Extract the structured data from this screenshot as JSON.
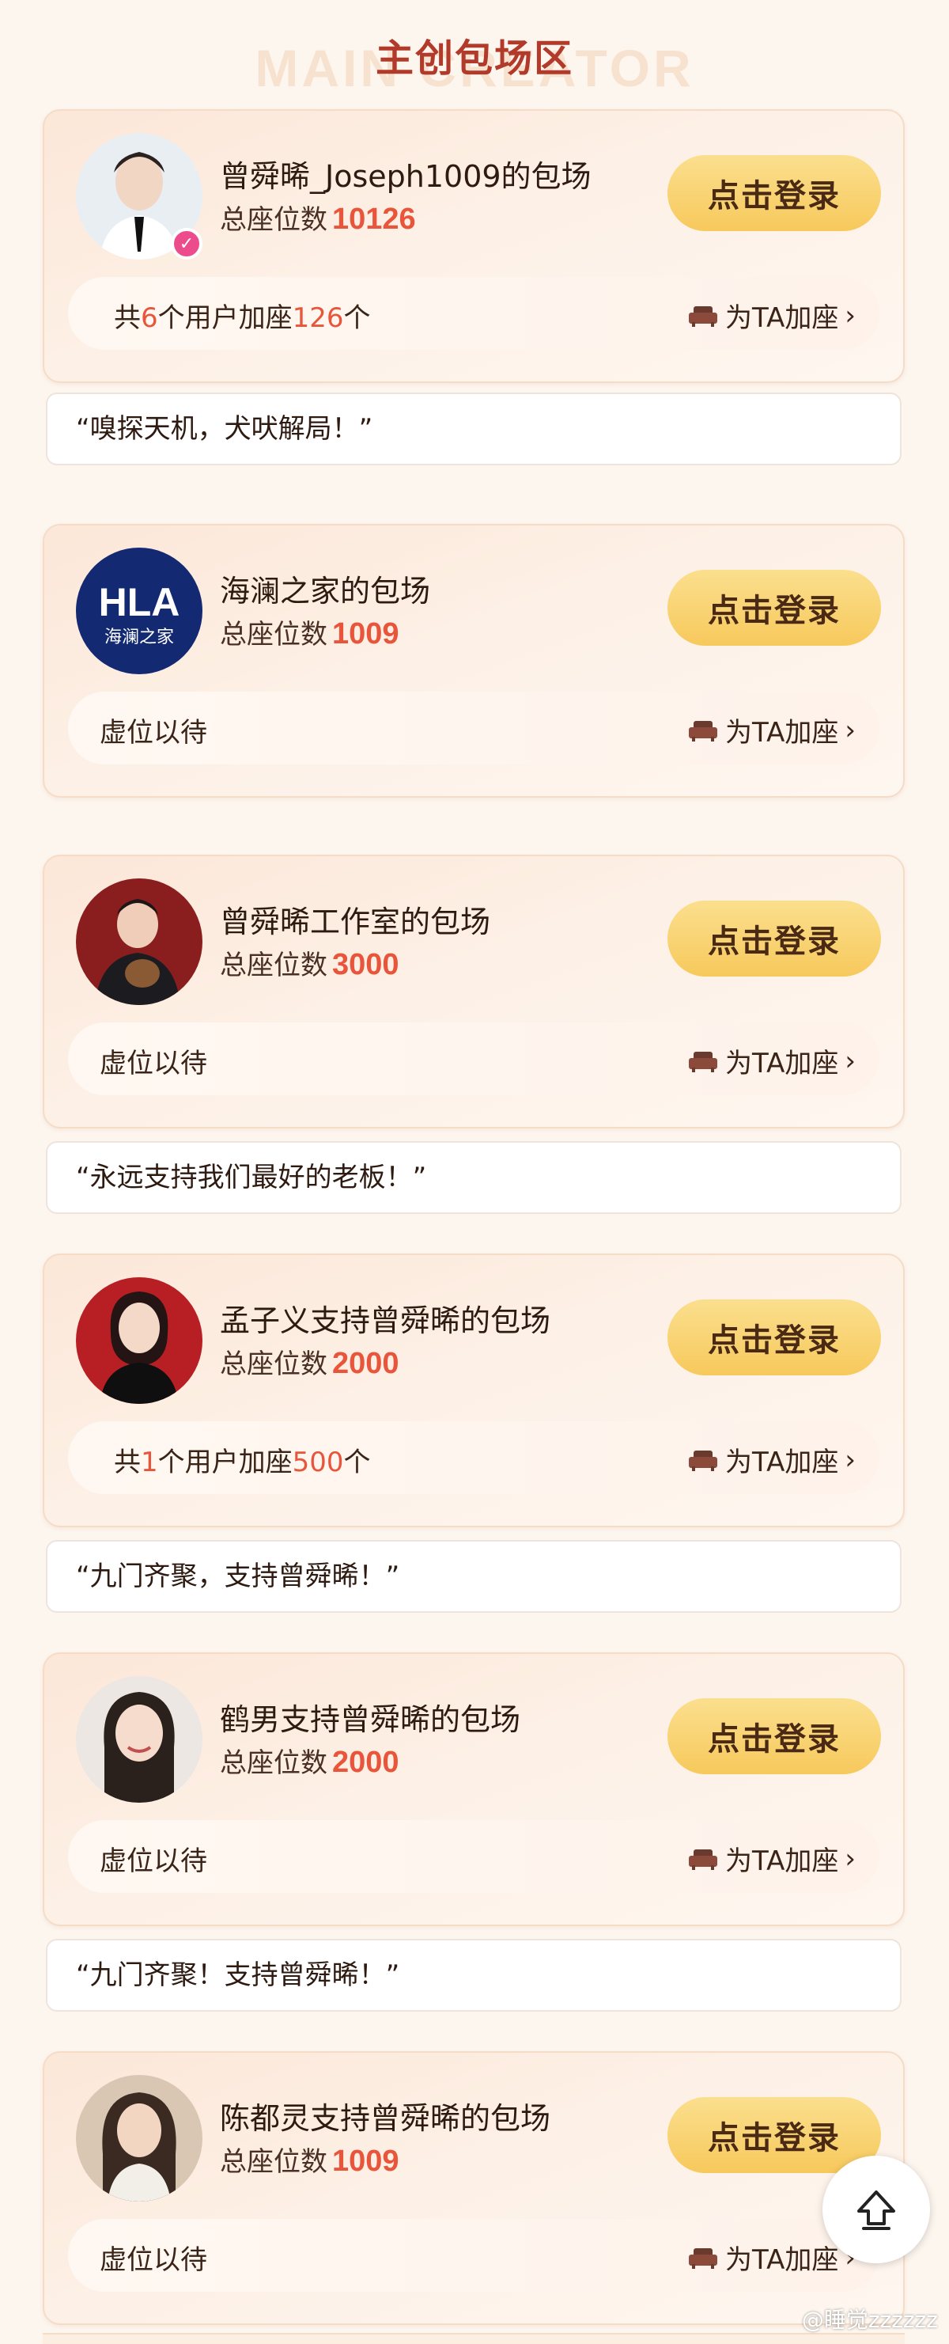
{
  "header": {
    "title": "主创包场区",
    "watermark": "MAIN CREATOR"
  },
  "login_label": "点击登录",
  "add_seat_label": "为TA加座",
  "seats_prefix": "总座位数",
  "cards": [
    {
      "name": "曾舜晞_Joseph1009的包场",
      "seats": "10126",
      "summary_parts": [
        "共",
        "6",
        "个用户加座",
        "126",
        "个"
      ],
      "quote": "“嗅探天机，犬吠解局！”",
      "verified": true
    },
    {
      "name": "海澜之家的包场",
      "seats": "1009",
      "summary": "虚位以待",
      "logo_text": "HLA",
      "logo_sub": "海澜之家"
    },
    {
      "name": "曾舜晞工作室的包场",
      "seats": "3000",
      "summary": "虚位以待",
      "quote": "“永远支持我们最好的老板！”"
    },
    {
      "name": "孟子义支持曾舜晞的包场",
      "seats": "2000",
      "summary_parts": [
        "共",
        "1",
        "个用户加座",
        "500",
        "个"
      ],
      "quote": "“九门齐聚，支持曾舜晞！”"
    },
    {
      "name": "鹤男支持曾舜晞的包场",
      "seats": "2000",
      "summary": "虚位以待",
      "quote": "“九门齐聚！支持曾舜晞！”"
    },
    {
      "name": "陈都灵支持曾舜晞的包场",
      "seats": "1009",
      "summary": "虚位以待"
    }
  ],
  "credit": "@睡觉zzzzzz",
  "colors": {
    "accent": "#e8553b",
    "button": "#f7c95c",
    "title": "#b23a2a"
  }
}
